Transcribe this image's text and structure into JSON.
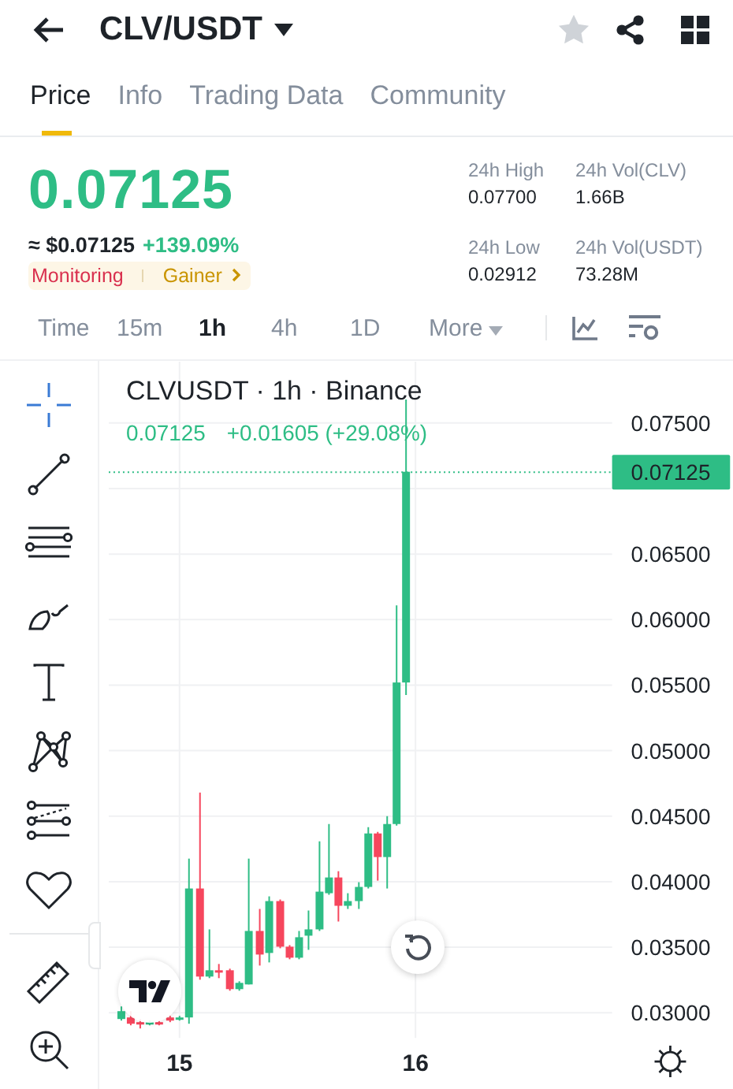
{
  "header": {
    "title": "CLV/USDT",
    "favorite": false
  },
  "tabs": [
    {
      "label": "Price",
      "selected": true
    },
    {
      "label": "Info",
      "selected": false
    },
    {
      "label": "Trading Data",
      "selected": false
    },
    {
      "label": "Community",
      "selected": false
    }
  ],
  "price": {
    "last": "0.07125",
    "fiat": "≈ $0.07125",
    "change": "+139.09%",
    "tags": [
      {
        "label": "Monitoring",
        "kind": "alert"
      },
      {
        "label": "Gainer",
        "kind": "gainer"
      }
    ]
  },
  "stats": [
    {
      "label": "24h High",
      "value": "0.07700"
    },
    {
      "label": "24h Vol(CLV)",
      "value": "1.66B"
    },
    {
      "label": "24h Low",
      "value": "0.02912"
    },
    {
      "label": "24h Vol(USDT)",
      "value": "73.28M"
    }
  ],
  "intervals": [
    {
      "label": "Time",
      "selected": false
    },
    {
      "label": "15m",
      "selected": false
    },
    {
      "label": "1h",
      "selected": true
    },
    {
      "label": "4h",
      "selected": false
    },
    {
      "label": "1D",
      "selected": false
    },
    {
      "label": "More",
      "selected": false,
      "kind": "menu"
    }
  ],
  "chart": {
    "title": "CLVUSDT · 1h · Binance",
    "last": "0.07125",
    "change": "+0.01605 (+29.08%)",
    "price_labels": [
      "0.07500",
      "0.06500",
      "0.06000",
      "0.05500",
      "0.05000",
      "0.04500",
      "0.04000",
      "0.03500",
      "0.03000"
    ],
    "current_tag": "0.07125",
    "time_labels": [
      "15",
      "16"
    ]
  }
}
